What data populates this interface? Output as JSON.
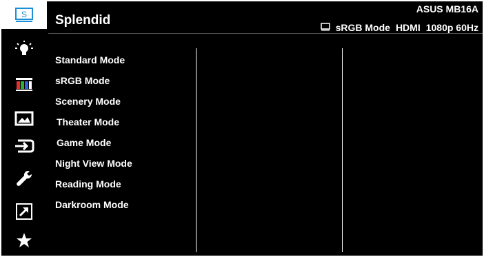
{
  "header": {
    "title": "Splendid",
    "model": "ASUS MB16A",
    "status": {
      "mode": "sRGB Mode",
      "input": "HDMI",
      "resolution": "1080p 60Hz"
    }
  },
  "sidebar": {
    "items": [
      {
        "name": "splendid-tab",
        "icon": "splendid-icon",
        "label": "S",
        "active": true
      },
      {
        "name": "blue-light-filter-tab",
        "icon": "bulb-icon",
        "active": false
      },
      {
        "name": "color-tab",
        "icon": "color-bars-icon",
        "active": false
      },
      {
        "name": "image-tab",
        "icon": "image-icon",
        "active": false
      },
      {
        "name": "input-select-tab",
        "icon": "input-icon",
        "active": false
      },
      {
        "name": "system-setup-tab",
        "icon": "wrench-icon",
        "active": false
      },
      {
        "name": "shortcut-tab",
        "icon": "arrow-icon",
        "active": false
      },
      {
        "name": "myfavorite-tab",
        "icon": "star-icon",
        "active": false
      }
    ]
  },
  "menu": {
    "items": [
      "Standard Mode",
      "sRGB Mode",
      "Scenery Mode",
      "Theater Mode",
      "Game Mode",
      "Night View Mode",
      "Reading Mode",
      "Darkroom Mode"
    ]
  },
  "colors": {
    "background": "#000000",
    "accent": "#1a8fd6",
    "text": "#ffffff"
  }
}
